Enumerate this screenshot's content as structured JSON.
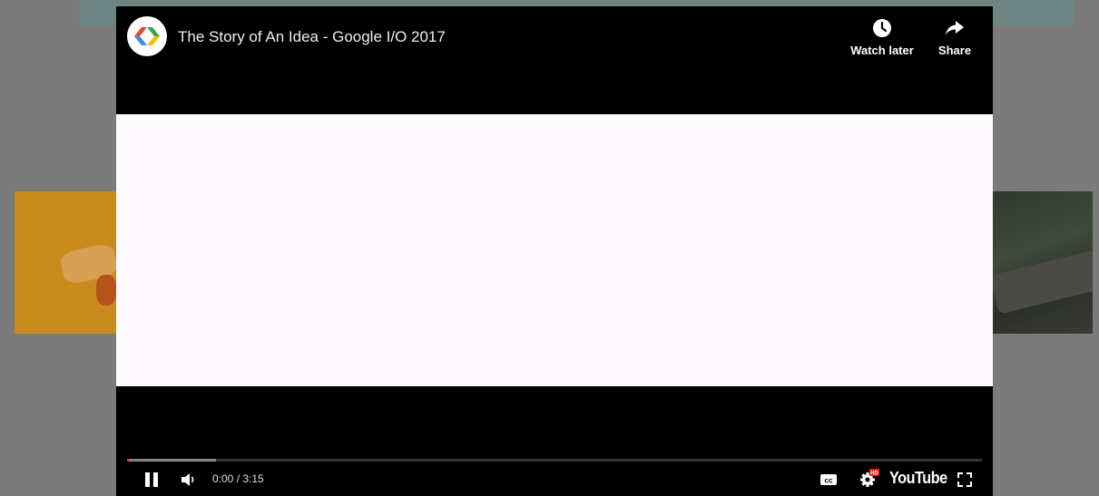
{
  "player": {
    "title": "The Story of An Idea - Google I/O 2017",
    "top_actions": {
      "watch_later_label": "Watch later",
      "share_label": "Share"
    },
    "controls": {
      "current_time": "0:00",
      "duration": "3:15",
      "time_text": "0:00 / 3:15",
      "youtube_label": "YouTube",
      "icons": [
        "pause-icon",
        "volume-icon",
        "cc-icon",
        "settings-hd-icon",
        "fullscreen-icon"
      ]
    },
    "progress": {
      "played_fraction": 0.001,
      "buffered_fraction": 0.104
    }
  },
  "colors": {
    "player_background": "#000000",
    "video_frame": "#fdfbfd",
    "progress_played": "#f12b24",
    "hd_badge": "#e62117",
    "overlay_background": "#7b7b7b"
  }
}
